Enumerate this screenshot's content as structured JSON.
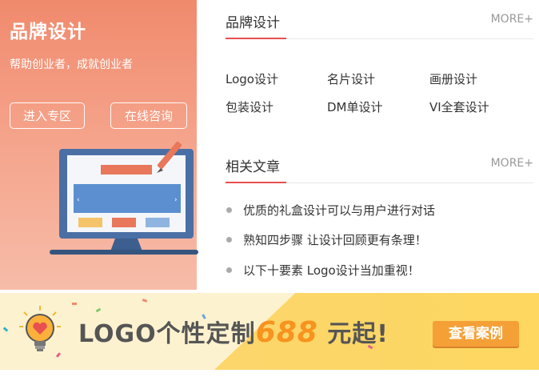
{
  "promo": {
    "title": "品牌设计",
    "subtitle": "帮助创业者，成就创业者",
    "enter_button": "进入专区",
    "consult_button": "在线咨询"
  },
  "brand_section": {
    "title": "品牌设计",
    "more": "MORE+",
    "links": [
      "Logo设计",
      "名片设计",
      "画册设计",
      "包装设计",
      "DM单设计",
      "VI全套设计"
    ]
  },
  "articles_section": {
    "title": "相关文章",
    "more": "MORE+",
    "items": [
      "优质的礼盒设计可以与用户进行对话",
      "熟知四步骤 让设计回顾更有条理！",
      "以下十要素 Logo设计当加重视！"
    ]
  },
  "banner": {
    "text_before": "LOGO个性定制",
    "price": "688",
    "text_after": "元起!",
    "button": "查看案例"
  },
  "colors": {
    "accent_red": "#e84f4f",
    "promo_gradient_top": "#f08a6c",
    "banner_yellow": "#fcd66b",
    "price_orange": "#f7931e",
    "banner_button": "#f5a037"
  },
  "icons": [
    "monitor-illustration",
    "pen-icon",
    "lightbulb-icon",
    "heart-icon"
  ]
}
